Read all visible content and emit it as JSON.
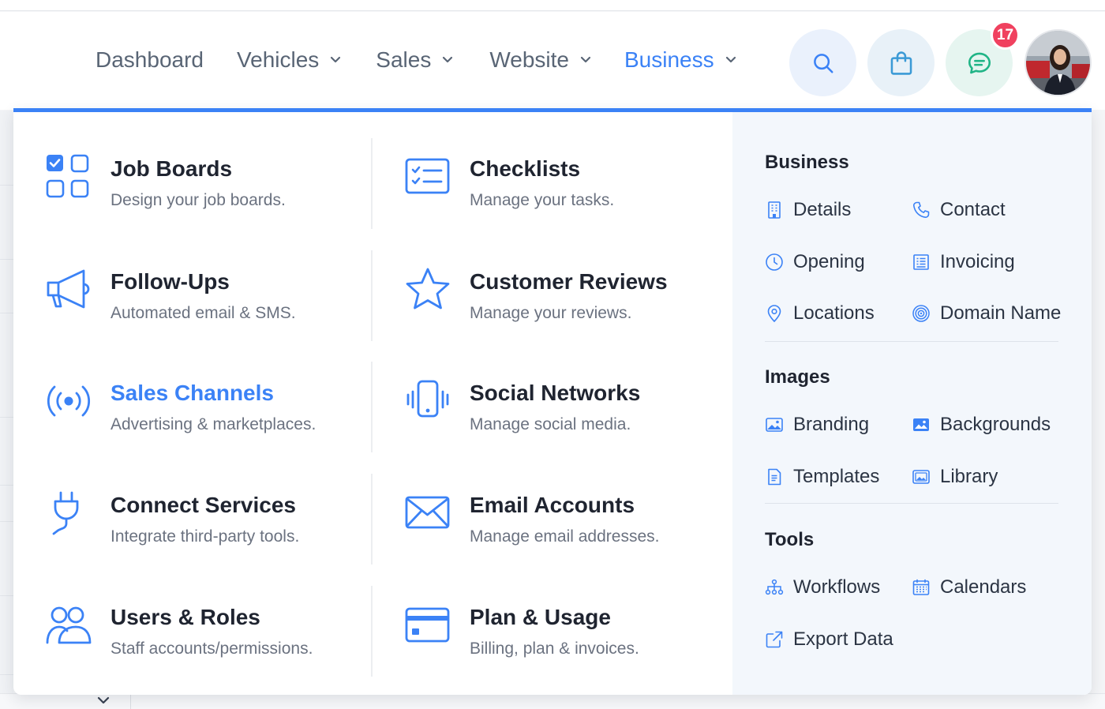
{
  "nav": {
    "items": [
      {
        "label": "Dashboard"
      },
      {
        "label": "Vehicles"
      },
      {
        "label": "Sales"
      },
      {
        "label": "Website"
      },
      {
        "label": "Business"
      }
    ],
    "active": "Business",
    "notification_count": "17"
  },
  "menu": {
    "tiles": [
      {
        "title": "Job Boards",
        "subtitle": "Design your job boards.",
        "icon": "job-boards-icon"
      },
      {
        "title": "Checklists",
        "subtitle": "Manage your tasks.",
        "icon": "checklist-icon"
      },
      {
        "title": "Follow-Ups",
        "subtitle": "Automated email & SMS.",
        "icon": "megaphone-icon"
      },
      {
        "title": "Customer Reviews",
        "subtitle": "Manage your reviews.",
        "icon": "star-icon"
      },
      {
        "title": "Sales Channels",
        "subtitle": "Advertising & marketplaces.",
        "icon": "broadcast-icon"
      },
      {
        "title": "Social Networks",
        "subtitle": "Manage social media.",
        "icon": "phone-vibrate-icon"
      },
      {
        "title": "Connect Services",
        "subtitle": "Integrate third-party tools.",
        "icon": "plug-icon"
      },
      {
        "title": "Email Accounts",
        "subtitle": "Manage email addresses.",
        "icon": "envelope-icon"
      },
      {
        "title": "Users & Roles",
        "subtitle": "Staff accounts/permissions.",
        "icon": "users-icon"
      },
      {
        "title": "Plan & Usage",
        "subtitle": "Billing, plan & invoices.",
        "icon": "credit-card-icon"
      }
    ],
    "sidebar": {
      "business": {
        "title": "Business",
        "links": [
          "Details",
          "Contact",
          "Opening",
          "Invoicing",
          "Locations",
          "Domain Name"
        ]
      },
      "images": {
        "title": "Images",
        "links": [
          "Branding",
          "Backgrounds",
          "Templates",
          "Library"
        ]
      },
      "tools": {
        "title": "Tools",
        "links": [
          "Workflows",
          "Calendars",
          "Export Data"
        ]
      }
    }
  },
  "colors": {
    "accent": "#3b82f6",
    "badge": "#f0415f",
    "nav_text": "#596575",
    "sidebar_bg": "#f3f7fc"
  }
}
